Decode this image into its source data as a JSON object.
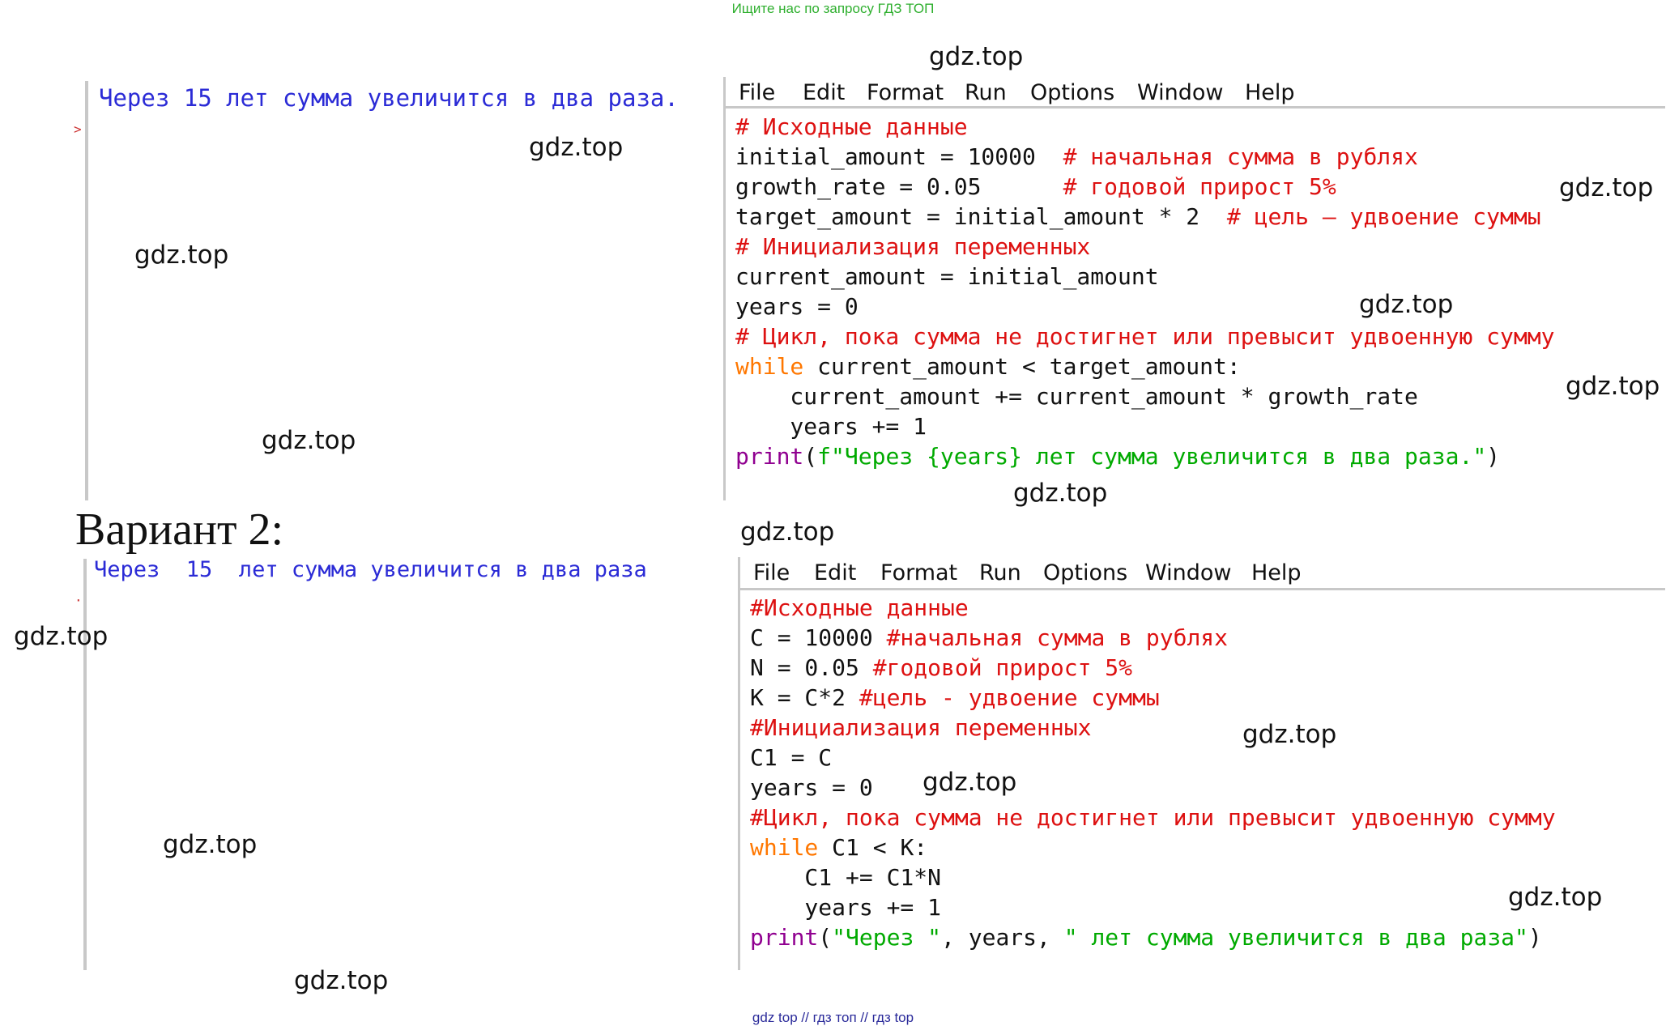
{
  "banner": "Ищите нас по запросу ГДЗ ТОП",
  "footer": "gdz top  //  гдз топ  //  гдз top",
  "variant2_heading": "Вариант 2:",
  "watermark": "gdz.top",
  "panel1": {
    "shell_output": "Через 15 лет сумма увеличится в два раза.",
    "prompt": ">",
    "menu": [
      "File",
      "Edit",
      "Format",
      "Run",
      "Options",
      "Window",
      "Help"
    ],
    "code": [
      [
        {
          "t": "# Исходные данные",
          "c": "c-com"
        }
      ],
      [
        {
          "t": "initial_amount = 10000  ",
          "c": ""
        },
        {
          "t": "# начальная сумма в рублях",
          "c": "c-com"
        }
      ],
      [
        {
          "t": "growth_rate = 0.05      ",
          "c": ""
        },
        {
          "t": "# годовой прирост 5%",
          "c": "c-com"
        }
      ],
      [
        {
          "t": "target_amount = initial_amount * 2  ",
          "c": ""
        },
        {
          "t": "# цель — удвоение суммы",
          "c": "c-com"
        }
      ],
      [
        {
          "t": "# Инициализация переменных",
          "c": "c-com"
        }
      ],
      [
        {
          "t": "current_amount = initial_amount",
          "c": ""
        }
      ],
      [
        {
          "t": "years = 0",
          "c": ""
        }
      ],
      [
        {
          "t": "# Цикл, пока сумма не достигнет или превысит удвоенную сумму",
          "c": "c-com"
        }
      ],
      [
        {
          "t": "while",
          "c": "c-kw"
        },
        {
          "t": " current_amount < target_amount:",
          "c": ""
        }
      ],
      [
        {
          "t": "    current_amount += current_amount * growth_rate",
          "c": ""
        }
      ],
      [
        {
          "t": "    years += 1",
          "c": ""
        }
      ],
      [
        {
          "t": "print",
          "c": "c-bi"
        },
        {
          "t": "(",
          "c": ""
        },
        {
          "t": "f\"Через {years} лет сумма увеличится в два раза.\"",
          "c": "c-str"
        },
        {
          "t": ")",
          "c": ""
        }
      ]
    ]
  },
  "panel2": {
    "shell_output": "Через  15  лет сумма увеличится в два раза",
    "prompt": "·",
    "menu": [
      "File",
      "Edit",
      "Format",
      "Run",
      "Options",
      "Window",
      "Help"
    ],
    "code": [
      [
        {
          "t": "#Исходные данные",
          "c": "c-com"
        }
      ],
      [
        {
          "t": "C = 10000 ",
          "c": ""
        },
        {
          "t": "#начальная сумма в рублях",
          "c": "c-com"
        }
      ],
      [
        {
          "t": "N = 0.05 ",
          "c": ""
        },
        {
          "t": "#годовой прирост 5%",
          "c": "c-com"
        }
      ],
      [
        {
          "t": "K = C*2 ",
          "c": ""
        },
        {
          "t": "#цель - удвоение суммы",
          "c": "c-com"
        }
      ],
      [
        {
          "t": "#Инициализация переменных",
          "c": "c-com"
        }
      ],
      [
        {
          "t": "C1 = C",
          "c": ""
        }
      ],
      [
        {
          "t": "years = 0",
          "c": ""
        }
      ],
      [
        {
          "t": "#Цикл, пока сумма не достигнет или превысит удвоенную сумму",
          "c": "c-com"
        }
      ],
      [
        {
          "t": "while",
          "c": "c-kw"
        },
        {
          "t": " C1 < K:",
          "c": ""
        }
      ],
      [
        {
          "t": "    C1 += C1*N",
          "c": ""
        }
      ],
      [
        {
          "t": "    years += 1",
          "c": ""
        }
      ],
      [
        {
          "t": "print",
          "c": "c-bi"
        },
        {
          "t": "(",
          "c": ""
        },
        {
          "t": "\"Через \"",
          "c": "c-str"
        },
        {
          "t": ", years, ",
          "c": ""
        },
        {
          "t": "\" лет сумма увеличится в два раза\"",
          "c": "c-str"
        },
        {
          "t": ")",
          "c": ""
        }
      ]
    ]
  }
}
